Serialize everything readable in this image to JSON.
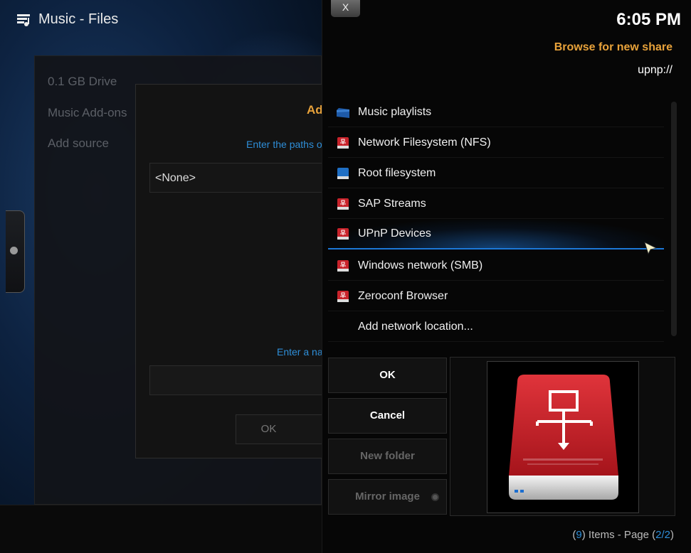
{
  "header": {
    "title": "Music - Files"
  },
  "left_list": {
    "items": [
      "0.1 GB Drive",
      "Music Add-ons",
      "Add source"
    ]
  },
  "add_source_dialog": {
    "title_fragment": "Ad",
    "paths_hint": "Enter the paths or",
    "path_entry": "<None>",
    "name_hint": "Enter a nam",
    "ok_label": "OK"
  },
  "browse_dialog": {
    "close_label": "X",
    "clock": "6:05 PM",
    "title": "Browse for new share",
    "path": "upnp://",
    "items": [
      {
        "label": "Music playlists",
        "icon": "folder-icon"
      },
      {
        "label": "Network Filesystem (NFS)",
        "icon": "network-drive-icon"
      },
      {
        "label": "Root filesystem",
        "icon": "hard-drive-icon"
      },
      {
        "label": "SAP Streams",
        "icon": "network-drive-icon"
      },
      {
        "label": "UPnP Devices",
        "icon": "network-drive-icon"
      },
      {
        "label": "Windows network (SMB)",
        "icon": "network-drive-icon"
      },
      {
        "label": "Zeroconf Browser",
        "icon": "network-drive-icon"
      },
      {
        "label": "Add network location...",
        "icon": ""
      }
    ],
    "selected_index": 4,
    "buttons": {
      "ok": "OK",
      "cancel": "Cancel",
      "new_folder": "New folder",
      "mirror_image": "Mirror image"
    },
    "status": {
      "count": "9",
      "items_text": " Items - Page (",
      "page": "2/2",
      "close_paren": ")"
    }
  },
  "colors": {
    "accent_orange": "#e8a23a",
    "accent_blue": "#2e8ed8",
    "drive_red": "#c8232b"
  }
}
